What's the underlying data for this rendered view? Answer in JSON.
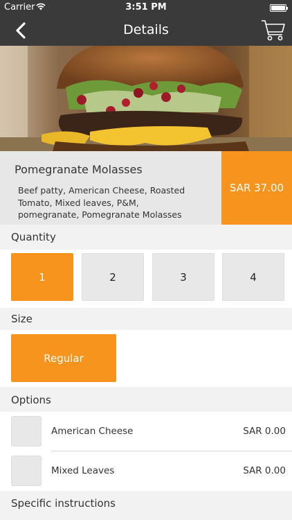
{
  "status_bar": {
    "carrier": "Carrier",
    "time": "3:51 PM"
  },
  "nav": {
    "title": "Details"
  },
  "product": {
    "name": "Pomegranate Molasses",
    "description": "Beef patty, American Cheese, Roasted Tomato, Mixed leaves, P&M, pomegranate, Pomegranate Molasses",
    "price": "SAR 37.00"
  },
  "quantity": {
    "label": "Quantity",
    "options": [
      "1",
      "2",
      "3",
      "4"
    ],
    "selected": "1"
  },
  "size": {
    "label": "Size",
    "options": [
      "Regular"
    ],
    "selected": "Regular"
  },
  "options": {
    "label": "Options",
    "items": [
      {
        "label": "American Cheese",
        "price": "SAR 0.00"
      },
      {
        "label": "Mixed Leaves",
        "price": "SAR 0.00"
      }
    ]
  },
  "instructions": {
    "label": "Specific instructions"
  },
  "colors": {
    "accent": "#f7941d",
    "nav": "#3a3a3a",
    "tile": "#e9e8e8"
  },
  "icons": {
    "back": "chevron-left-icon",
    "cart": "shopping-cart-icon",
    "wifi": "wifi-icon",
    "battery": "battery-icon"
  }
}
